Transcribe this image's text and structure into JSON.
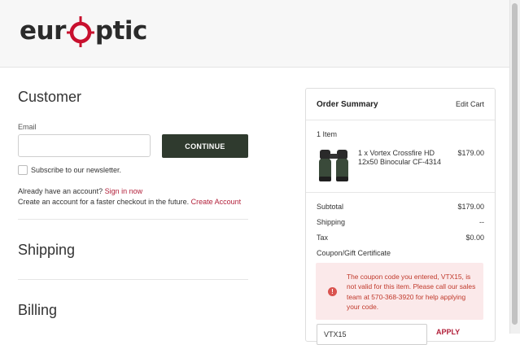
{
  "brand": {
    "logo_text_left": "eur",
    "logo_text_right": "ptic",
    "logo_accent": "#c8102e"
  },
  "customer": {
    "title": "Customer",
    "email_label": "Email",
    "email_value": "",
    "continue_label": "CONTINUE",
    "newsletter_label": "Subscribe to our newsletter.",
    "have_account_text": "Already have an account?",
    "sign_in_link": "Sign in now",
    "create_text": "Create an account for a faster checkout in the future.",
    "create_link": "Create Account"
  },
  "shipping": {
    "title": "Shipping"
  },
  "billing": {
    "title": "Billing"
  },
  "summary": {
    "title": "Order Summary",
    "edit_cart": "Edit Cart",
    "item_count": "1 Item",
    "item": {
      "name_line1": "1 x Vortex Crossfire HD",
      "name_line2": "12x50 Binocular CF-4314",
      "price": "$179.00"
    },
    "subtotal_label": "Subtotal",
    "subtotal_value": "$179.00",
    "shipping_label": "Shipping",
    "shipping_value": "--",
    "tax_label": "Tax",
    "tax_value": "$0.00",
    "coupon_link": "Coupon/Gift Certificate",
    "coupon_error": "The coupon code you entered, VTX15, is not valid for this item. Please call our sales team at 570-368-3920 for help applying your code.",
    "coupon_value": "VTX15",
    "apply_label": "APPLY"
  },
  "colors": {
    "link": "#b2203a",
    "button_bg": "#2f3a2e",
    "alert_bg": "#fbe9ea",
    "alert_text": "#c0392b"
  }
}
